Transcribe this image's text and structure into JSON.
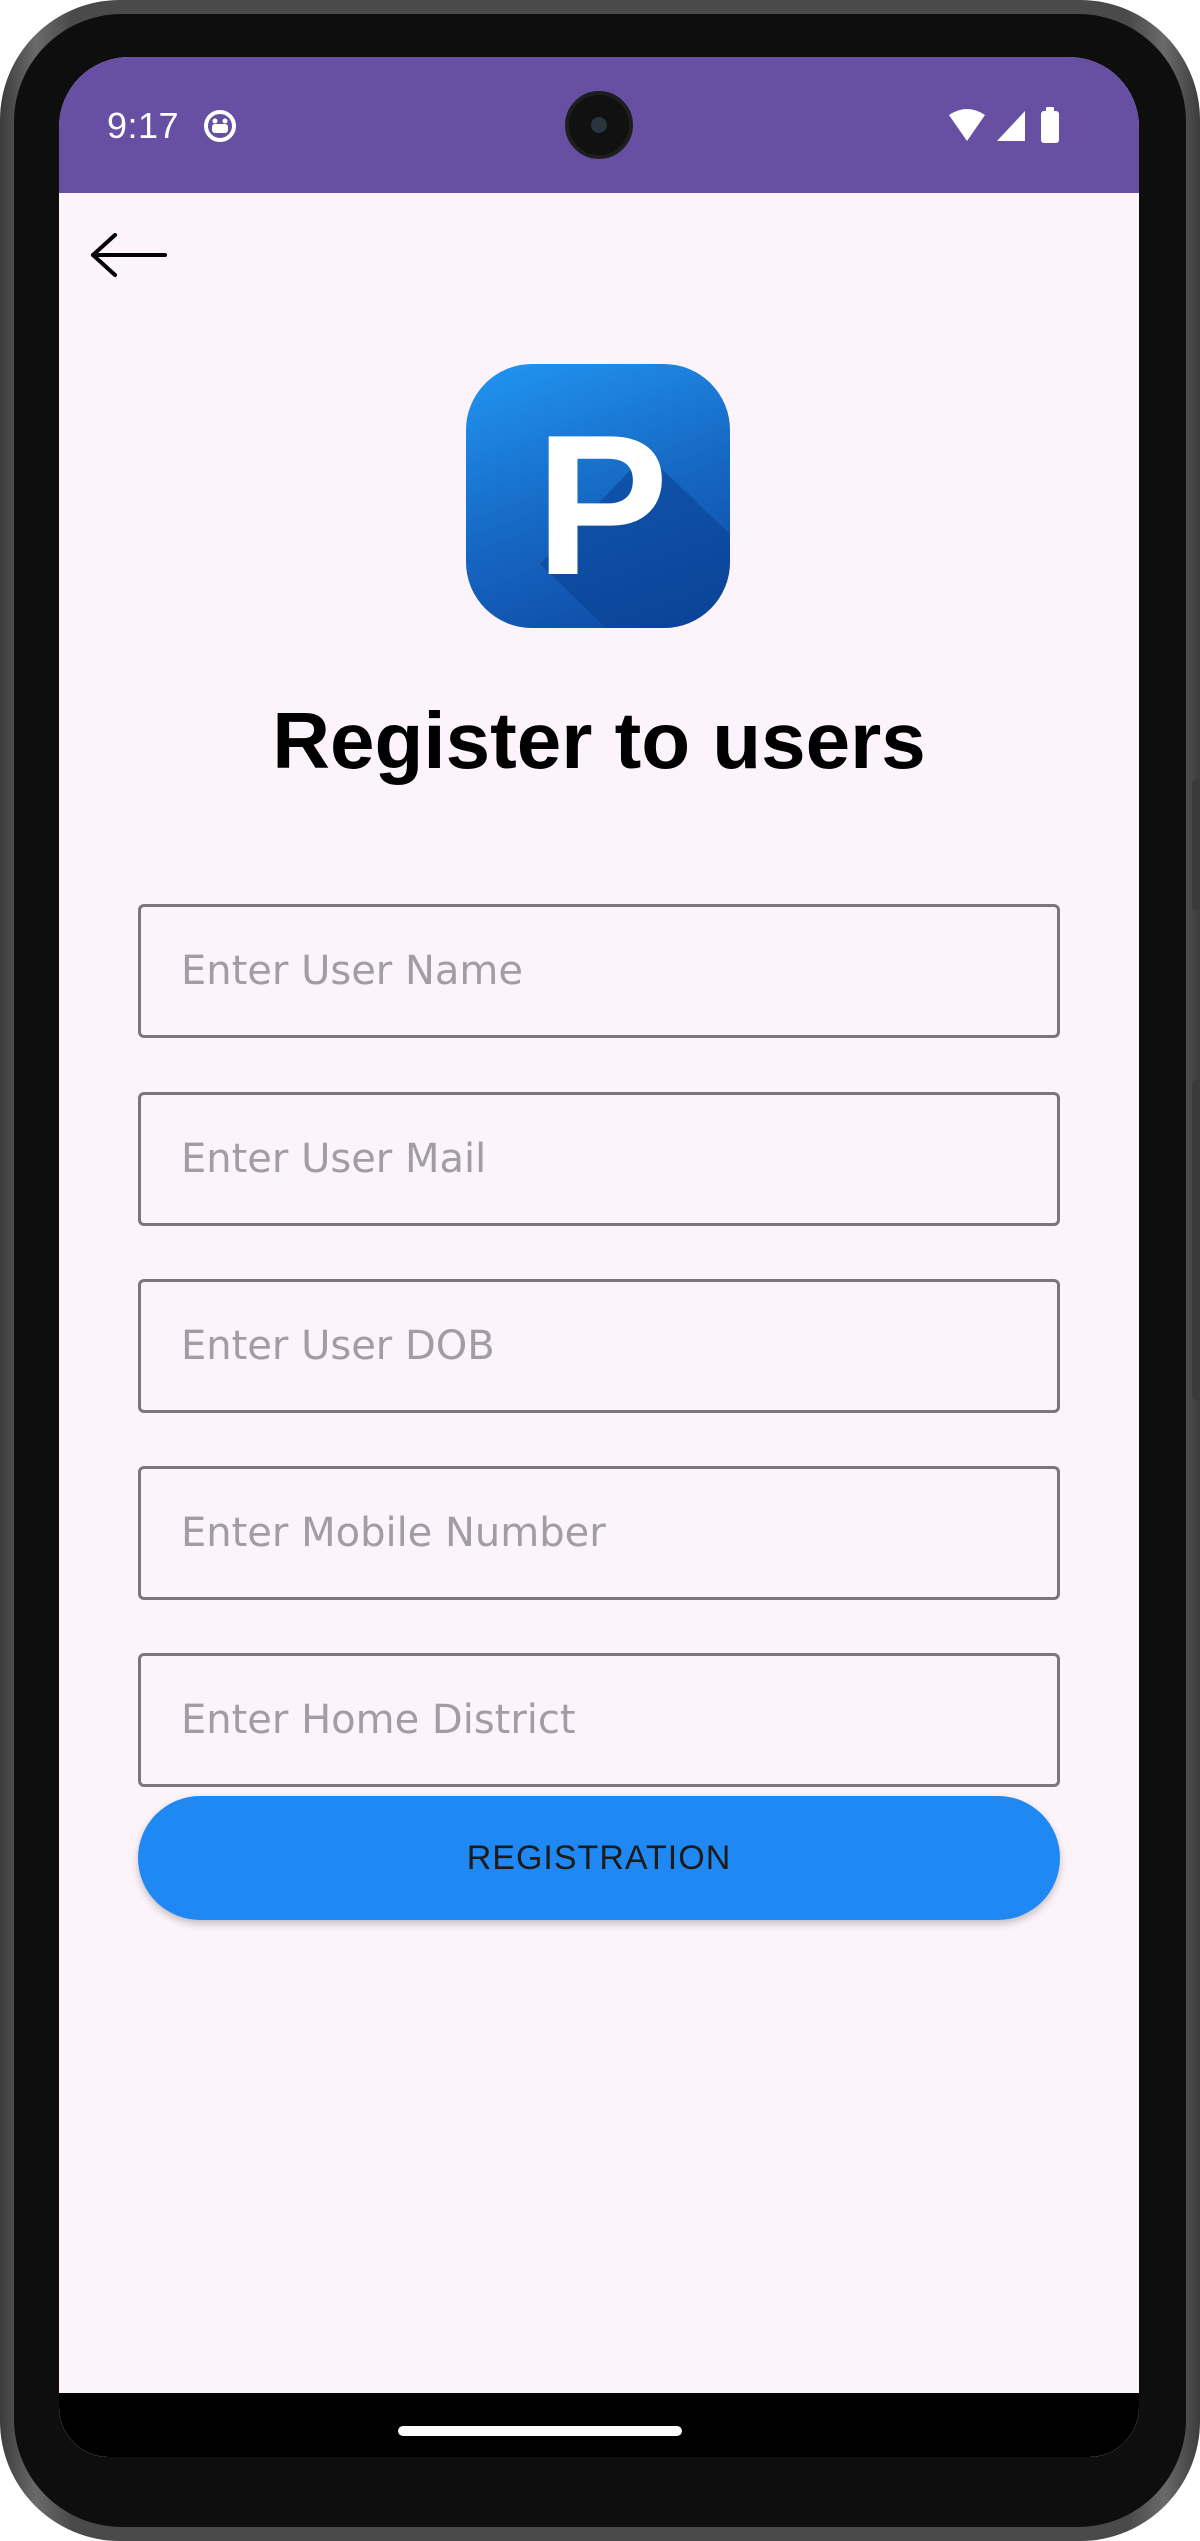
{
  "status_bar": {
    "time": "9:17",
    "background_color": "#6750a4",
    "icons": [
      "notification-face-icon",
      "wifi-icon",
      "signal-icon",
      "battery-icon"
    ]
  },
  "app": {
    "back_icon": "arrow-left-icon",
    "logo_letter": "P",
    "logo_colors": [
      "#2196f3",
      "#0d47a1"
    ],
    "title": "Register to users",
    "fields": [
      {
        "name": "user-name-field",
        "placeholder": "Enter User Name",
        "value": ""
      },
      {
        "name": "user-mail-field",
        "placeholder": "Enter User Mail",
        "value": ""
      },
      {
        "name": "user-dob-field",
        "placeholder": "Enter User DOB",
        "value": ""
      },
      {
        "name": "mobile-number-field",
        "placeholder": "Enter Mobile Number",
        "value": ""
      },
      {
        "name": "home-district-field",
        "placeholder": "Enter Home District",
        "value": ""
      }
    ],
    "register_button_label": "REGISTRATION",
    "accent_color": "#2088f3",
    "background_color": "#fcf4fa"
  }
}
